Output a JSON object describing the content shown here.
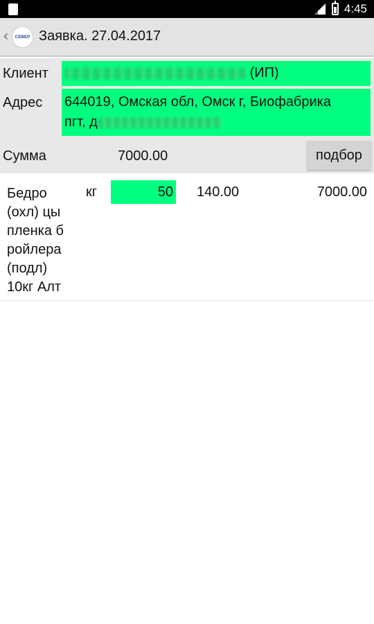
{
  "status_bar": {
    "time": "4:45"
  },
  "action_bar": {
    "title": "Заявка. 27.04.2017",
    "logo_text": "СЕВЕР"
  },
  "header": {
    "client_label": "Клиент",
    "client_suffix": "(ИП)",
    "address_label": "Адрес",
    "address_line1": "644019, Омская обл, Омск г, Биофабрика",
    "address_line2_prefix": "пгт, д",
    "sum_label": "Сумма",
    "sum_value": "7000.00",
    "pick_button_label": "подбор"
  },
  "items": [
    {
      "name": "Бедро (охл) цы пленка б ройлера (подл) 10кг Алт",
      "unit": "кг",
      "quantity": "50",
      "price": "140.00",
      "total": "7000.00"
    }
  ],
  "colors": {
    "highlight": "#00ff7f",
    "header_bg": "#e8e8e8",
    "actionbar_bg": "#e3e3e3"
  }
}
